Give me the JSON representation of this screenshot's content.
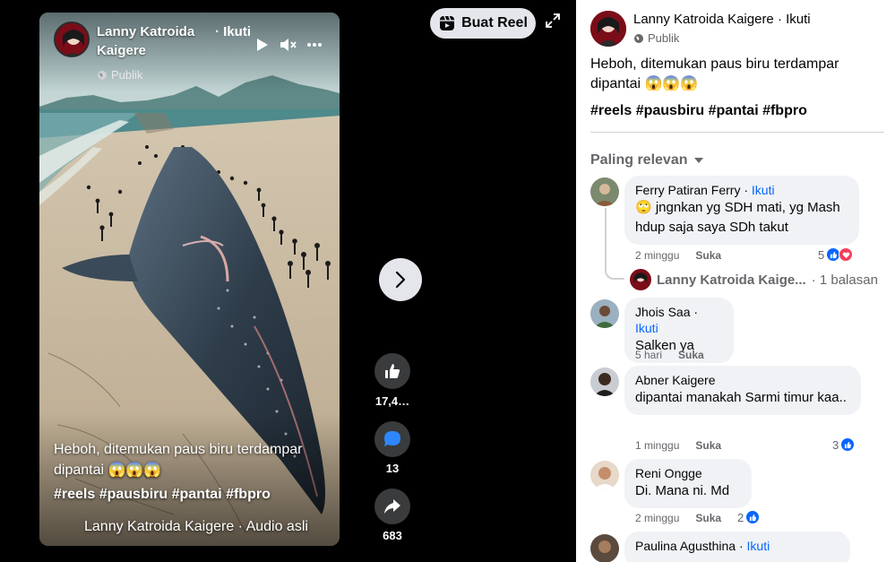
{
  "video": {
    "author": "Lanny Katroida Kaigere",
    "follow": "· Ikuti",
    "privacy": "Publik",
    "caption": "Heboh, ditemukan paus biru terdampar dipantai 😱😱😱",
    "hashtags": "#reels #pausbiru #pantai #fbpro",
    "audio": "Lanny Katroida Kaigere · Audio asli"
  },
  "actions": {
    "likes": "17,4…",
    "comments": "13",
    "shares": "683",
    "create_reel": "Buat Reel"
  },
  "post": {
    "author": "Lanny Katroida Kaigere",
    "follow": " · Ikuti",
    "privacy": "Publik",
    "caption": "Heboh, ditemukan paus biru terdampar dipantai 😱😱😱",
    "hashtags": "#reels #pausbiru #pantai #fbpro",
    "sort_label": "Paling relevan"
  },
  "comments": [
    {
      "author": "Ferry Patiran Ferry",
      "follow": "Ikuti",
      "text": "🙄 jngnkan yg SDH mati, yg Mash hdup saja saya SDh takut",
      "time": "2 minggu",
      "like": "Suka",
      "reactions": "5"
    },
    {
      "author": "Jhois Saa",
      "follow": "Ikuti",
      "text": "Salken ya",
      "time": "5 hari",
      "like": "Suka",
      "reactions": ""
    },
    {
      "author": "Abner Kaigere",
      "follow": "",
      "text": "dipantai manakah Sarmi timur kaa..",
      "time": "1 minggu",
      "like": "Suka",
      "reactions": "3"
    },
    {
      "author": "Reni Ongge",
      "follow": "",
      "text": "Di. Mana ni. Md",
      "time": "2 minggu",
      "like": "Suka",
      "reactions": "2"
    },
    {
      "author": "Paulina Agusthina",
      "follow": "Ikuti",
      "text": "",
      "time": "",
      "like": "",
      "reactions": ""
    }
  ],
  "reply": {
    "author": "Lanny Katroida Kaige...",
    "count": "· 1 balasan"
  },
  "colors": {
    "accent": "#0866ff",
    "like_blue": "#0866ff",
    "love_red": "#f33e58",
    "bubble": "#f0f2f5"
  }
}
